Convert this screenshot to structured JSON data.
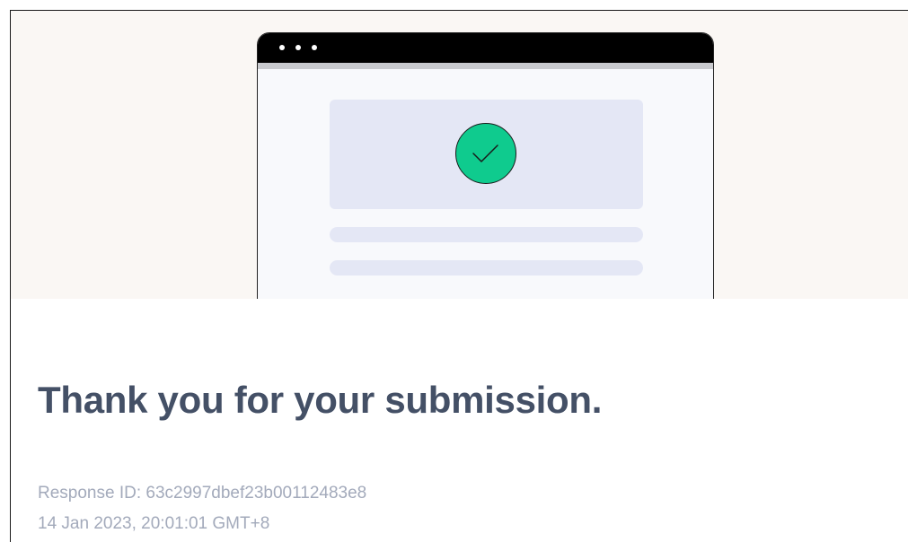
{
  "confirmation": {
    "title": "Thank you for your submission.",
    "response_id": "Response ID: 63c2997dbef23b00112483e8",
    "timestamp": "14 Jan 2023, 20:01:01 GMT+8"
  },
  "illustration": {
    "icon": "check-circle-icon",
    "accent_color": "#0fcb8e",
    "hero_background": "#faf7f4",
    "placeholder_color": "#e4e7f5",
    "title_color": "#445066",
    "meta_color": "#a3aabb"
  }
}
